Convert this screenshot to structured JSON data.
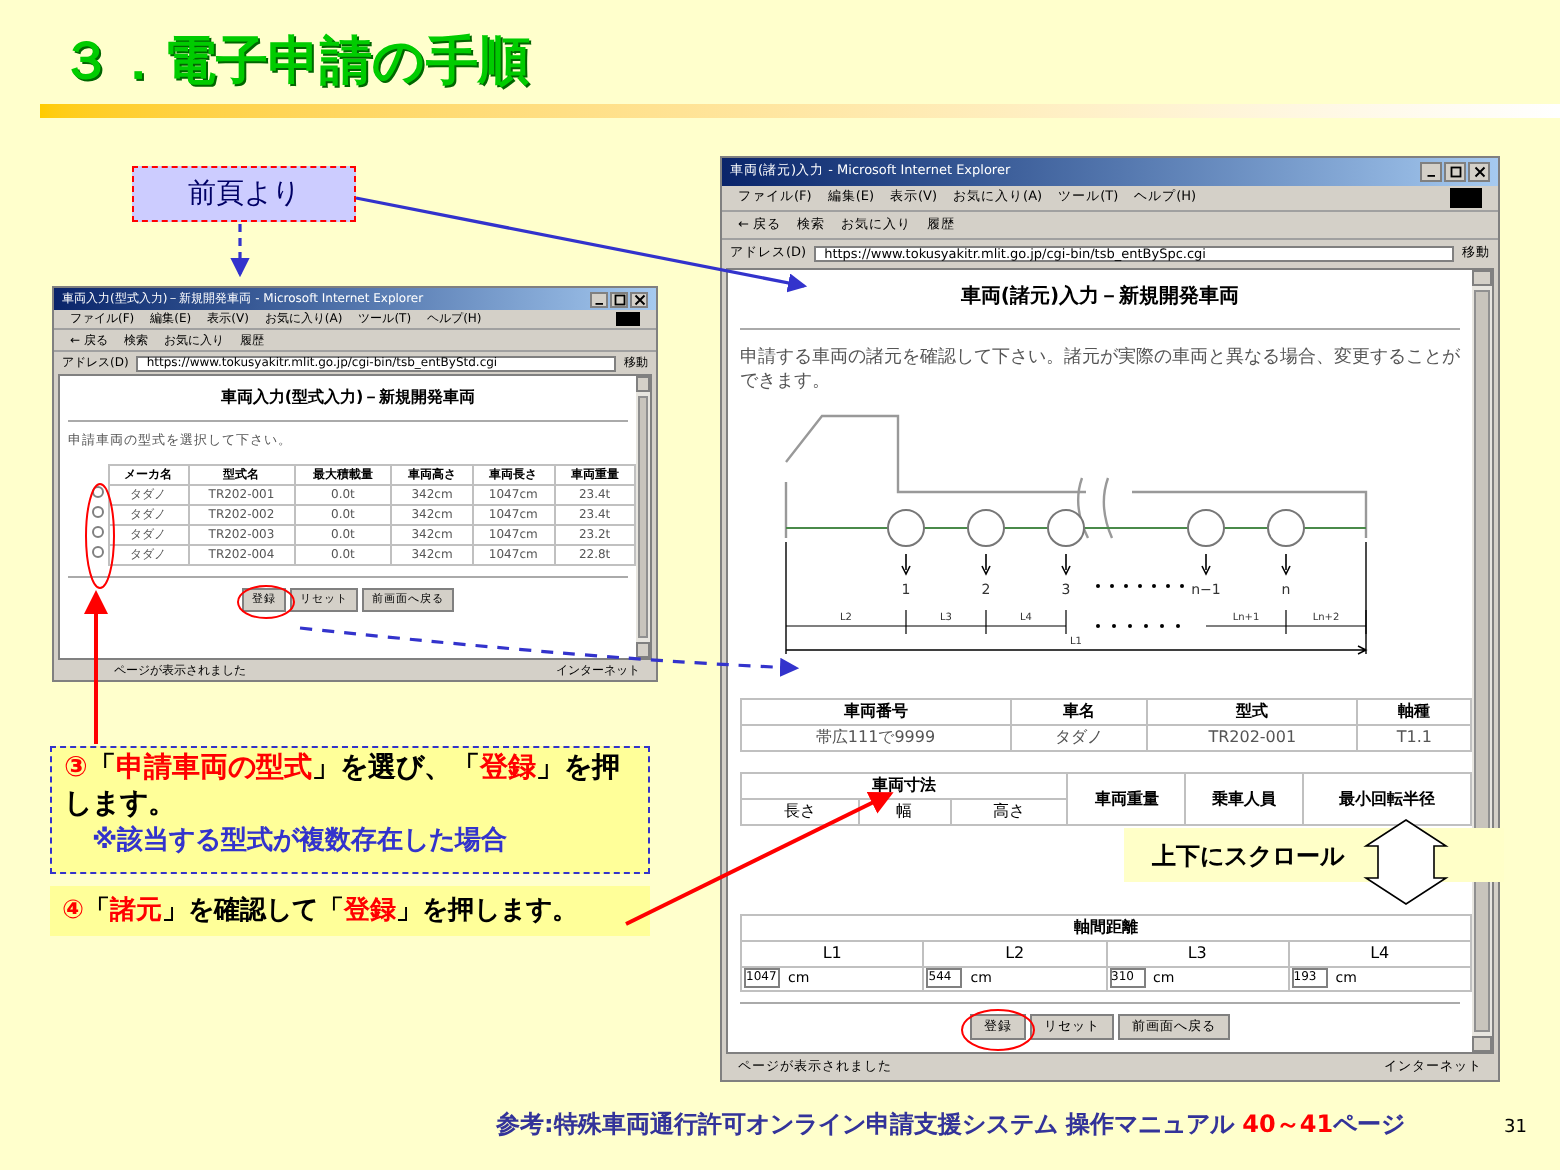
{
  "slide": {
    "title": "３．電子申請の手順",
    "page_number": "31"
  },
  "from_prev": "前頁より",
  "left_window": {
    "title": "車両入力(型式入力)－新規開発車両 - Microsoft Internet Explorer",
    "menu": [
      "ファイル(F)",
      "編集(E)",
      "表示(V)",
      "お気に入り(A)",
      "ツール(T)",
      "ヘルプ(H)"
    ],
    "toolbar": [
      "← 戻る",
      "検索",
      "お気に入り",
      "履歴"
    ],
    "address_label": "アドレス(D)",
    "address": "https://www.tokusyakitr.mlit.go.jp/cgi-bin/tsb_entByStd.cgi",
    "go": "移動",
    "status": "ページが表示されました",
    "zone": "インターネット",
    "heading": "車両入力(型式入力)－新規開発車両",
    "instruction": "申請車両の型式を選択して下さい。",
    "table": {
      "columns": [
        "メーカ名",
        "型式名",
        "最大積載量",
        "車両高さ",
        "車両長さ",
        "車両重量"
      ],
      "rows": [
        {
          "selected": false,
          "cells": [
            "タダノ",
            "TR202-001",
            "0.0t",
            "342cm",
            "1047cm",
            "23.4t"
          ]
        },
        {
          "selected": false,
          "cells": [
            "タダノ",
            "TR202-002",
            "0.0t",
            "342cm",
            "1047cm",
            "23.4t"
          ]
        },
        {
          "selected": false,
          "cells": [
            "タダノ",
            "TR202-003",
            "0.0t",
            "342cm",
            "1047cm",
            "23.2t"
          ]
        },
        {
          "selected": false,
          "cells": [
            "タダノ",
            "TR202-004",
            "0.0t",
            "342cm",
            "1047cm",
            "22.8t"
          ]
        }
      ]
    },
    "buttons": [
      "登録",
      "リセット",
      "前画面へ戻る"
    ]
  },
  "right_window": {
    "title": "車両(諸元)入力 - Microsoft Internet Explorer",
    "menu": [
      "ファイル(F)",
      "編集(E)",
      "表示(V)",
      "お気に入り(A)",
      "ツール(T)",
      "ヘルプ(H)"
    ],
    "toolbar": [
      "← 戻る",
      "検索",
      "お気に入り",
      "履歴"
    ],
    "address_label": "アドレス(D)",
    "address": "https://www.tokusyakitr.mlit.go.jp/cgi-bin/tsb_entBySpc.cgi",
    "go": "移動",
    "status": "ページが表示されました",
    "zone": "インターネット",
    "heading": "車両(諸元)入力－新規開発車両",
    "instruction": "申請する車両の諸元を確認して下さい。諸元が実際の車両と異なる場合、変更することができます。",
    "diagram": {
      "axles": [
        "1",
        "2",
        "3",
        "n−1",
        "n"
      ],
      "spans": [
        "L2",
        "L3",
        "L4",
        "Ln+1",
        "Ln+2"
      ],
      "total": "L1"
    },
    "vehicle_table": {
      "columns": [
        "車両番号",
        "車名",
        "型式",
        "軸種"
      ],
      "cells": [
        "帯広111で9999",
        "タダノ",
        "TR202-001",
        "T1.1"
      ]
    },
    "size_table": {
      "group": "車両寸法",
      "subcolumns": [
        "長さ",
        "幅",
        "高さ"
      ],
      "columns": [
        "車両重量",
        "乗車人員",
        "最小回転半径"
      ]
    },
    "axle_table": {
      "title": "軸間距離",
      "columns": [
        "L1",
        "L2",
        "L3",
        "L4"
      ],
      "values": [
        {
          "value": "1047",
          "unit": "cm"
        },
        {
          "value": "544",
          "unit": "cm"
        },
        {
          "value": "310",
          "unit": "cm"
        },
        {
          "value": "193",
          "unit": "cm"
        }
      ]
    },
    "buttons": [
      "登録",
      "リセット",
      "前画面へ戻る"
    ]
  },
  "step3": {
    "segments": [
      {
        "text": "③",
        "kind": "red"
      },
      {
        "text": "「",
        "kind": "plain"
      },
      {
        "text": "申請車両の型式",
        "kind": "red"
      },
      {
        "text": "」を選び、「",
        "kind": "plain"
      },
      {
        "text": "登録",
        "kind": "red"
      },
      {
        "text": "」を押します。",
        "kind": "plain"
      }
    ],
    "note": "※該当する型式が複数存在した場合"
  },
  "step4": {
    "segments": [
      {
        "text": "④",
        "kind": "red"
      },
      {
        "text": "「",
        "kind": "plain"
      },
      {
        "text": "諸元",
        "kind": "red"
      },
      {
        "text": "」を確認して「",
        "kind": "plain"
      },
      {
        "text": "登録",
        "kind": "red"
      },
      {
        "text": "」を押します。",
        "kind": "plain"
      }
    ]
  },
  "scroll_hint": "上下にスクロール",
  "footer": {
    "segments": [
      {
        "text": "参考:特殊車両通行許可オンライン申請支援システム 操作マニュアル ",
        "kind": "plain"
      },
      {
        "text": "40～41",
        "kind": "red"
      },
      {
        "text": "ページ",
        "kind": "plain"
      }
    ]
  }
}
